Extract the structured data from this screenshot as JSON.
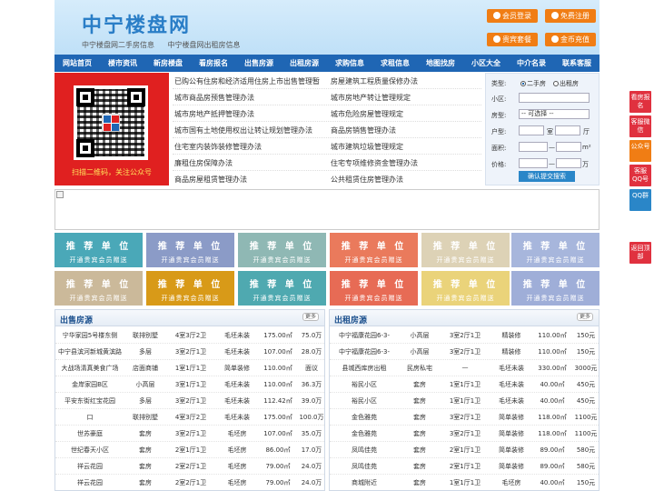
{
  "header": {
    "logo": "中宁楼盘网",
    "sub_links": [
      "中宁楼盘网二手房信息",
      "中宁楼盘网出租房信息"
    ],
    "buttons": [
      "会员登录",
      "免费注册",
      "贵宾套餐",
      "金币充值"
    ]
  },
  "nav": [
    "网站首页",
    "楼市资讯",
    "新房楼盘",
    "看房报名",
    "出售房源",
    "出租房源",
    "求购信息",
    "求租信息",
    "地图找房",
    "小区大全",
    "中介名录",
    "联系客服"
  ],
  "qr": {
    "caption": "扫描二维码，关注公众号"
  },
  "links": {
    "left": [
      "已购公有住房和经济适用住房上市出售管理暂",
      "城市商品房预售管理办法",
      "城市房地产抵押管理办法",
      "城市国有土地使用权出让转让规划管理办法",
      "住宅室内装饰装修管理办法",
      "廉租住房保障办法",
      "商品房屋租赁管理办法"
    ],
    "right": [
      "房屋建筑工程质量保修办法",
      "城市房地产转让管理规定",
      "城市危险房屋管理规定",
      "商品房销售管理办法",
      "城市建筑垃圾管理规定",
      "住宅专项维修资金管理办法",
      "公共租赁住房管理办法"
    ]
  },
  "search": {
    "type_label": "类型:",
    "type_opt1": "二手房",
    "type_opt2": "出租房",
    "community_label": "小区:",
    "housetype_label": "房型:",
    "housetype_value": "-- 可选择 --",
    "layout_label": "户型:",
    "room_unit": "室",
    "hall_unit": "厅",
    "area_label": "面积:",
    "area_sep": "—",
    "area_unit": "m²",
    "price_label": "价格:",
    "price_sep": "—",
    "price_unit": "万",
    "submit": "确认提交搜索"
  },
  "ads": {
    "line1": "推 荐 单 位",
    "line2": "开通贵宾会员赠送"
  },
  "sale": {
    "title": "出售房源",
    "more": "更多",
    "rows": [
      [
        "宁华家园5号楼东侧",
        "联排别墅",
        "4室3厅2卫",
        "毛坯未装",
        "175.00㎡",
        "75.0万"
      ],
      [
        "中宁县滨河新城黄滨路",
        "多层",
        "3室2厅1卫",
        "毛坯未装",
        "107.00㎡",
        "28.0万"
      ],
      [
        "大战场清真美食广场",
        "店面商铺",
        "1室1厅1卫",
        "简单装修",
        "110.00㎡",
        "面议"
      ],
      [
        "金岸家园B区",
        "小高层",
        "3室1厅1卫",
        "毛坯未装",
        "110.00㎡",
        "36.3万"
      ],
      [
        "平安东街红宝花园",
        "多层",
        "3室2厅1卫",
        "毛坯未装",
        "112.42㎡",
        "39.0万"
      ],
      [
        "口",
        "联排别墅",
        "4室3厅2卫",
        "毛坯未装",
        "175.00㎡",
        "100.0万"
      ],
      [
        "世苏豪庭",
        "套房",
        "3室2厅1卫",
        "毛坯房",
        "107.00㎡",
        "35.0万"
      ],
      [
        "世纪春天小区",
        "套房",
        "2室1厅1卫",
        "毛坯房",
        "86.00㎡",
        "17.0万"
      ],
      [
        "祥云花园",
        "套房",
        "2室2厅1卫",
        "毛坯房",
        "79.00㎡",
        "24.0万"
      ],
      [
        "祥云花园",
        "套房",
        "2室2厅1卫",
        "毛坯房",
        "79.00㎡",
        "24.0万"
      ]
    ]
  },
  "rent": {
    "title": "出租房源",
    "more": "更多",
    "rows": [
      [
        "中宁福康花园6-3-",
        "小高层",
        "3室2厅1卫",
        "精装修",
        "110.00㎡",
        "150元"
      ],
      [
        "中宁福康花园6-3-",
        "小高层",
        "3室2厅1卫",
        "精装修",
        "110.00㎡",
        "150元"
      ],
      [
        "县城西库房出租",
        "民房私宅",
        "—",
        "毛坯未装",
        "330.00㎡",
        "3000元"
      ],
      [
        "裕民小区",
        "套房",
        "1室1厅1卫",
        "毛坯未装",
        "40.00㎡",
        "450元"
      ],
      [
        "裕民小区",
        "套房",
        "1室1厅1卫",
        "毛坯未装",
        "40.00㎡",
        "450元"
      ],
      [
        "金色雅苑",
        "套房",
        "3室2厅1卫",
        "简单装修",
        "118.00㎡",
        "1100元"
      ],
      [
        "金色雅苑",
        "套房",
        "3室2厅1卫",
        "简单装修",
        "118.00㎡",
        "1100元"
      ],
      [
        "凤鸣佳苑",
        "套房",
        "2室1厅1卫",
        "简单装修",
        "89.00㎡",
        "580元"
      ],
      [
        "凤鸣佳苑",
        "套房",
        "2室1厅1卫",
        "简单装修",
        "89.00㎡",
        "580元"
      ],
      [
        "商城附近",
        "套房",
        "1室1厅1卫",
        "毛坯房",
        "40.00㎡",
        "150元"
      ]
    ]
  },
  "sidebar": [
    "看房报名",
    "客服微信",
    "公众号",
    "客服QQ号",
    "QQ群",
    "返回顶部"
  ],
  "colors": {
    "nav": "#1f66b4",
    "orange": "#f07d14",
    "red": "#e0313f"
  }
}
